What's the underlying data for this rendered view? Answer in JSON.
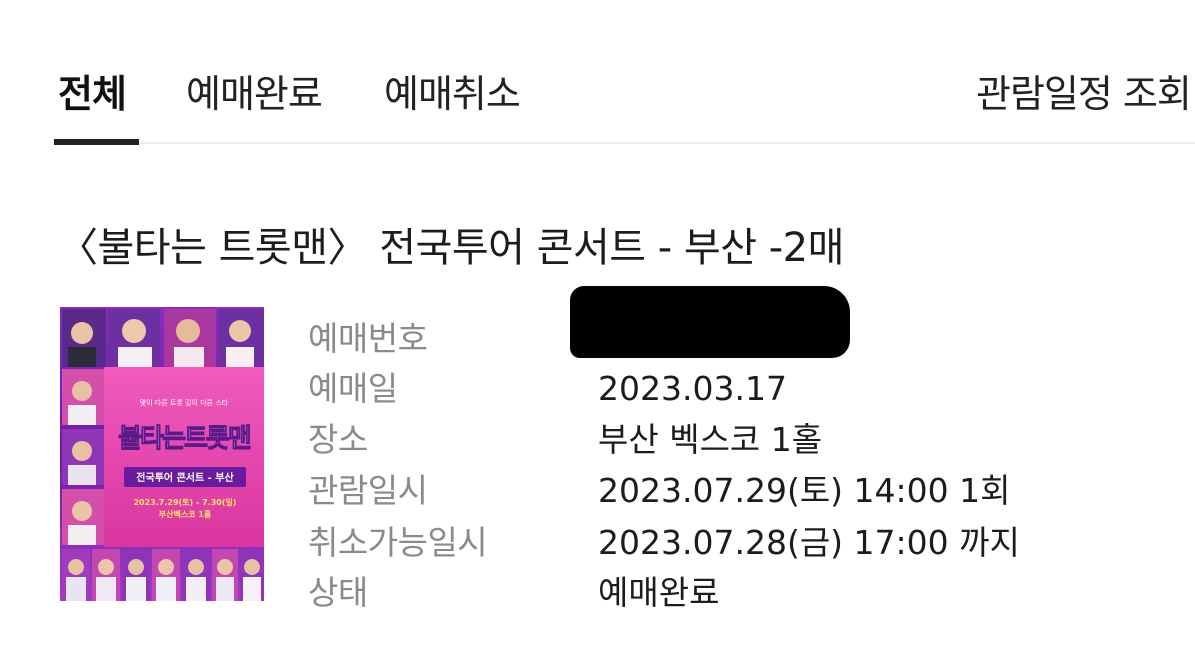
{
  "tabs": {
    "all": "전체",
    "completed": "예매완료",
    "cancelled": "예매취소",
    "schedule": "관람일정 조회"
  },
  "order": {
    "title": "〈불타는 트롯맨〉 전국투어 콘서트 - 부산  -2매",
    "fields": {
      "booking_number_label": "예매번호",
      "booking_number_value": "",
      "booking_date_label": "예매일",
      "booking_date_value": "2023.03.17",
      "venue_label": "장소",
      "venue_value": "부산 벡스코 1홀",
      "show_time_label": "관람일시",
      "show_time_value": "2023.07.29(토) 14:00 1회",
      "cancel_deadline_label": "취소가능일시",
      "cancel_deadline_value": "2023.07.28(금) 17:00 까지",
      "status_label": "상태",
      "status_value": "예매완료"
    }
  },
  "poster": {
    "top_line": "몇이 다른 트롯 길이 다른 스타",
    "logo": "불타는트롯맨",
    "subtitle": "전국투어 콘서트 - 부산",
    "dates": "2023.7.29(토) - 7.30(일)",
    "venue": "부산벡스코 1홀",
    "bg_color": "#7a1fb1",
    "accent_color": "#e83fa8"
  }
}
